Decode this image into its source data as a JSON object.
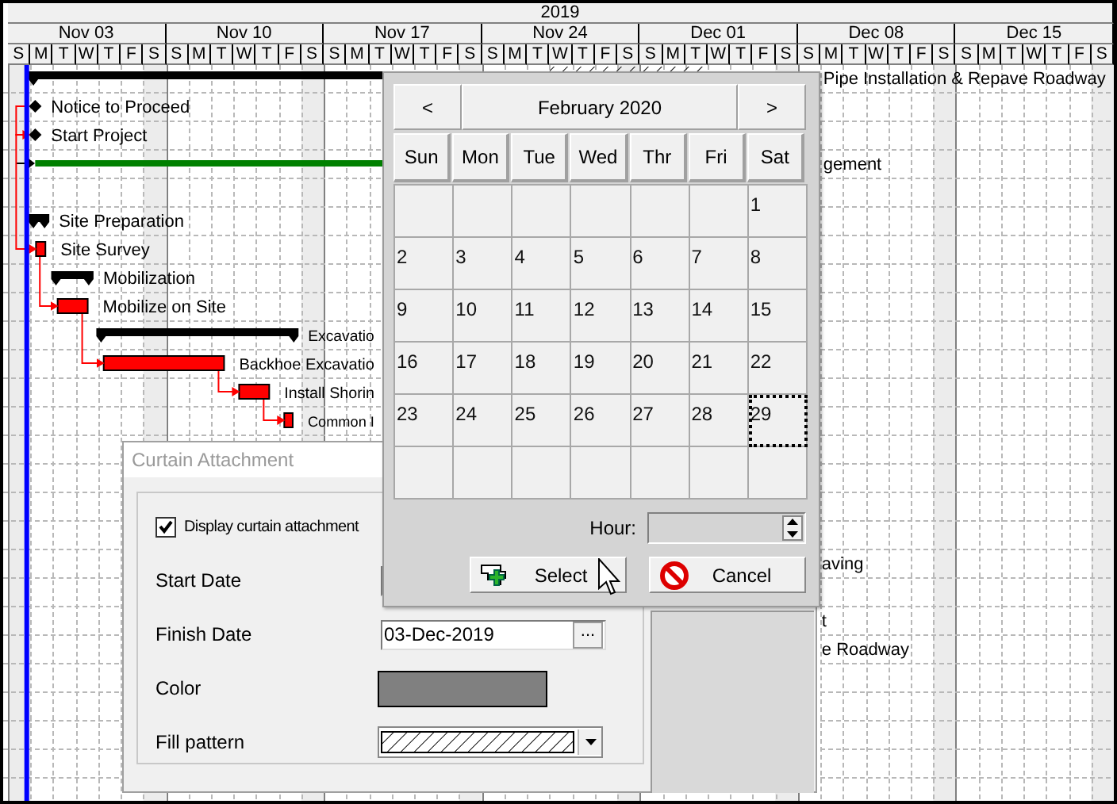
{
  "timeline": {
    "year": "2019",
    "weeks": [
      {
        "label": "Nov 03",
        "days": [
          {
            "label": "S",
            "shaded": true
          },
          {
            "label": "M",
            "shaded": false
          },
          {
            "label": "T",
            "shaded": false
          },
          {
            "label": "W",
            "shaded": false
          },
          {
            "label": "T",
            "shaded": false
          },
          {
            "label": "F",
            "shaded": false
          },
          {
            "label": "S",
            "shaded": true
          }
        ]
      },
      {
        "label": "Nov 10",
        "days": [
          {
            "label": "S",
            "shaded": false
          },
          {
            "label": "M",
            "shaded": false
          },
          {
            "label": "T",
            "shaded": false
          },
          {
            "label": "W",
            "shaded": false
          },
          {
            "label": "T",
            "shaded": false
          },
          {
            "label": "F",
            "shaded": false
          },
          {
            "label": "S",
            "shaded": true
          }
        ]
      },
      {
        "label": "Nov 17",
        "days": [
          {
            "label": "S",
            "shaded": false
          },
          {
            "label": "M",
            "shaded": false
          },
          {
            "label": "T",
            "shaded": false
          },
          {
            "label": "W",
            "shaded": false
          },
          {
            "label": "T",
            "shaded": false
          },
          {
            "label": "F",
            "shaded": false
          },
          {
            "label": "S",
            "shaded": true
          }
        ]
      },
      {
        "label": "Nov 24",
        "days": [
          {
            "label": "S",
            "shaded": false
          },
          {
            "label": "M",
            "shaded": false
          },
          {
            "label": "T",
            "shaded": false
          },
          {
            "label": "W",
            "shaded": false
          },
          {
            "label": "T",
            "shaded": false
          },
          {
            "label": "F",
            "shaded": false
          },
          {
            "label": "S",
            "shaded": true
          }
        ]
      },
      {
        "label": "Dec 01",
        "days": [
          {
            "label": "S",
            "shaded": false
          },
          {
            "label": "M",
            "shaded": false
          },
          {
            "label": "T",
            "shaded": false
          },
          {
            "label": "W",
            "shaded": false
          },
          {
            "label": "T",
            "shaded": false
          },
          {
            "label": "F",
            "shaded": false
          },
          {
            "label": "S",
            "shaded": true
          }
        ]
      },
      {
        "label": "Dec 08",
        "days": [
          {
            "label": "S",
            "shaded": false
          },
          {
            "label": "M",
            "shaded": false
          },
          {
            "label": "T",
            "shaded": false
          },
          {
            "label": "W",
            "shaded": false
          },
          {
            "label": "T",
            "shaded": false
          },
          {
            "label": "F",
            "shaded": false
          },
          {
            "label": "S",
            "shaded": true
          }
        ]
      },
      {
        "label": "Dec 15",
        "days": [
          {
            "label": "S",
            "shaded": false
          },
          {
            "label": "M",
            "shaded": false
          },
          {
            "label": "T",
            "shaded": false
          },
          {
            "label": "W",
            "shaded": false
          },
          {
            "label": "T",
            "shaded": false
          },
          {
            "label": "F",
            "shaded": false
          },
          {
            "label": "S",
            "shaded": true
          }
        ]
      }
    ]
  },
  "gantt": {
    "rows": [
      {
        "kind": "summary",
        "label": "Pipe Installation & Repave Roadway"
      },
      {
        "kind": "milestone",
        "label": "Notice to Proceed"
      },
      {
        "kind": "milestone",
        "label": "Start Project",
        "linked": true
      },
      {
        "kind": "hammock",
        "label": "gement"
      },
      {
        "kind": "blank"
      },
      {
        "kind": "summary",
        "label": "Site Preparation"
      },
      {
        "kind": "task",
        "label": "Site Survey",
        "linked": true
      },
      {
        "kind": "summary",
        "label": "Mobilization"
      },
      {
        "kind": "task",
        "label": "Mobilize on Site",
        "linked": true
      },
      {
        "kind": "summary",
        "label": "Excavatio"
      },
      {
        "kind": "task",
        "label": "Backhoe Excavatio",
        "linked": true
      },
      {
        "kind": "task",
        "label": "Install Shorin",
        "linked": true
      },
      {
        "kind": "task",
        "label": "Common I",
        "linked": true
      },
      {
        "kind": "blank"
      },
      {
        "kind": "blank"
      },
      {
        "kind": "blank"
      },
      {
        "kind": "blank"
      },
      {
        "kind": "label",
        "label": "aving"
      },
      {
        "kind": "blank"
      },
      {
        "kind": "label",
        "label": "t"
      },
      {
        "kind": "label",
        "label": "e Roadway"
      }
    ]
  },
  "curtain_dialog": {
    "title": "Curtain Attachment",
    "active": false,
    "display": {
      "label": "Display curtain attachment",
      "checked": true
    },
    "fields": [
      {
        "kind": "date",
        "label": "Start Date"
      },
      {
        "kind": "date",
        "label": "Finish Date",
        "value": "03-Dec-2019",
        "button": "..."
      },
      {
        "kind": "color",
        "label": "Color",
        "color": "#808080"
      },
      {
        "kind": "pattern",
        "label": "Fill pattern"
      }
    ]
  },
  "calendar_popup": {
    "prev": "<",
    "title": "February 2020",
    "next": ">",
    "weekdays": [
      "Sun",
      "Mon",
      "Tue",
      "Wed",
      "Thr",
      "Fri",
      "Sat"
    ],
    "weeks": [
      {
        "days": [
          {
            "label": "1",
            "selected": false
          }
        ]
      },
      {
        "days": [
          {
            "label": "2",
            "selected": false
          },
          {
            "label": "3",
            "selected": false
          },
          {
            "label": "4",
            "selected": false
          },
          {
            "label": "5",
            "selected": false
          },
          {
            "label": "6",
            "selected": false
          },
          {
            "label": "7",
            "selected": false
          },
          {
            "label": "8",
            "selected": false
          }
        ]
      },
      {
        "days": [
          {
            "label": "9",
            "selected": false
          },
          {
            "label": "10",
            "selected": false
          },
          {
            "label": "11",
            "selected": false
          },
          {
            "label": "12",
            "selected": false
          },
          {
            "label": "13",
            "selected": false
          },
          {
            "label": "14",
            "selected": false
          },
          {
            "label": "15",
            "selected": false
          }
        ]
      },
      {
        "days": [
          {
            "label": "16",
            "selected": false
          },
          {
            "label": "17",
            "selected": false
          },
          {
            "label": "18",
            "selected": false
          },
          {
            "label": "19",
            "selected": false
          },
          {
            "label": "20",
            "selected": false
          },
          {
            "label": "21",
            "selected": false
          },
          {
            "label": "22",
            "selected": false
          }
        ]
      },
      {
        "days": [
          {
            "label": "23",
            "selected": false
          },
          {
            "label": "24",
            "selected": false
          },
          {
            "label": "25",
            "selected": false
          },
          {
            "label": "26",
            "selected": false
          },
          {
            "label": "27",
            "selected": false
          },
          {
            "label": "28",
            "selected": false
          },
          {
            "label": "29",
            "selected": true
          }
        ]
      }
    ],
    "hour_label": "Hour:",
    "buttons": [
      {
        "kind": "select",
        "label": "Select"
      },
      {
        "kind": "cancel",
        "label": "Cancel"
      }
    ]
  }
}
